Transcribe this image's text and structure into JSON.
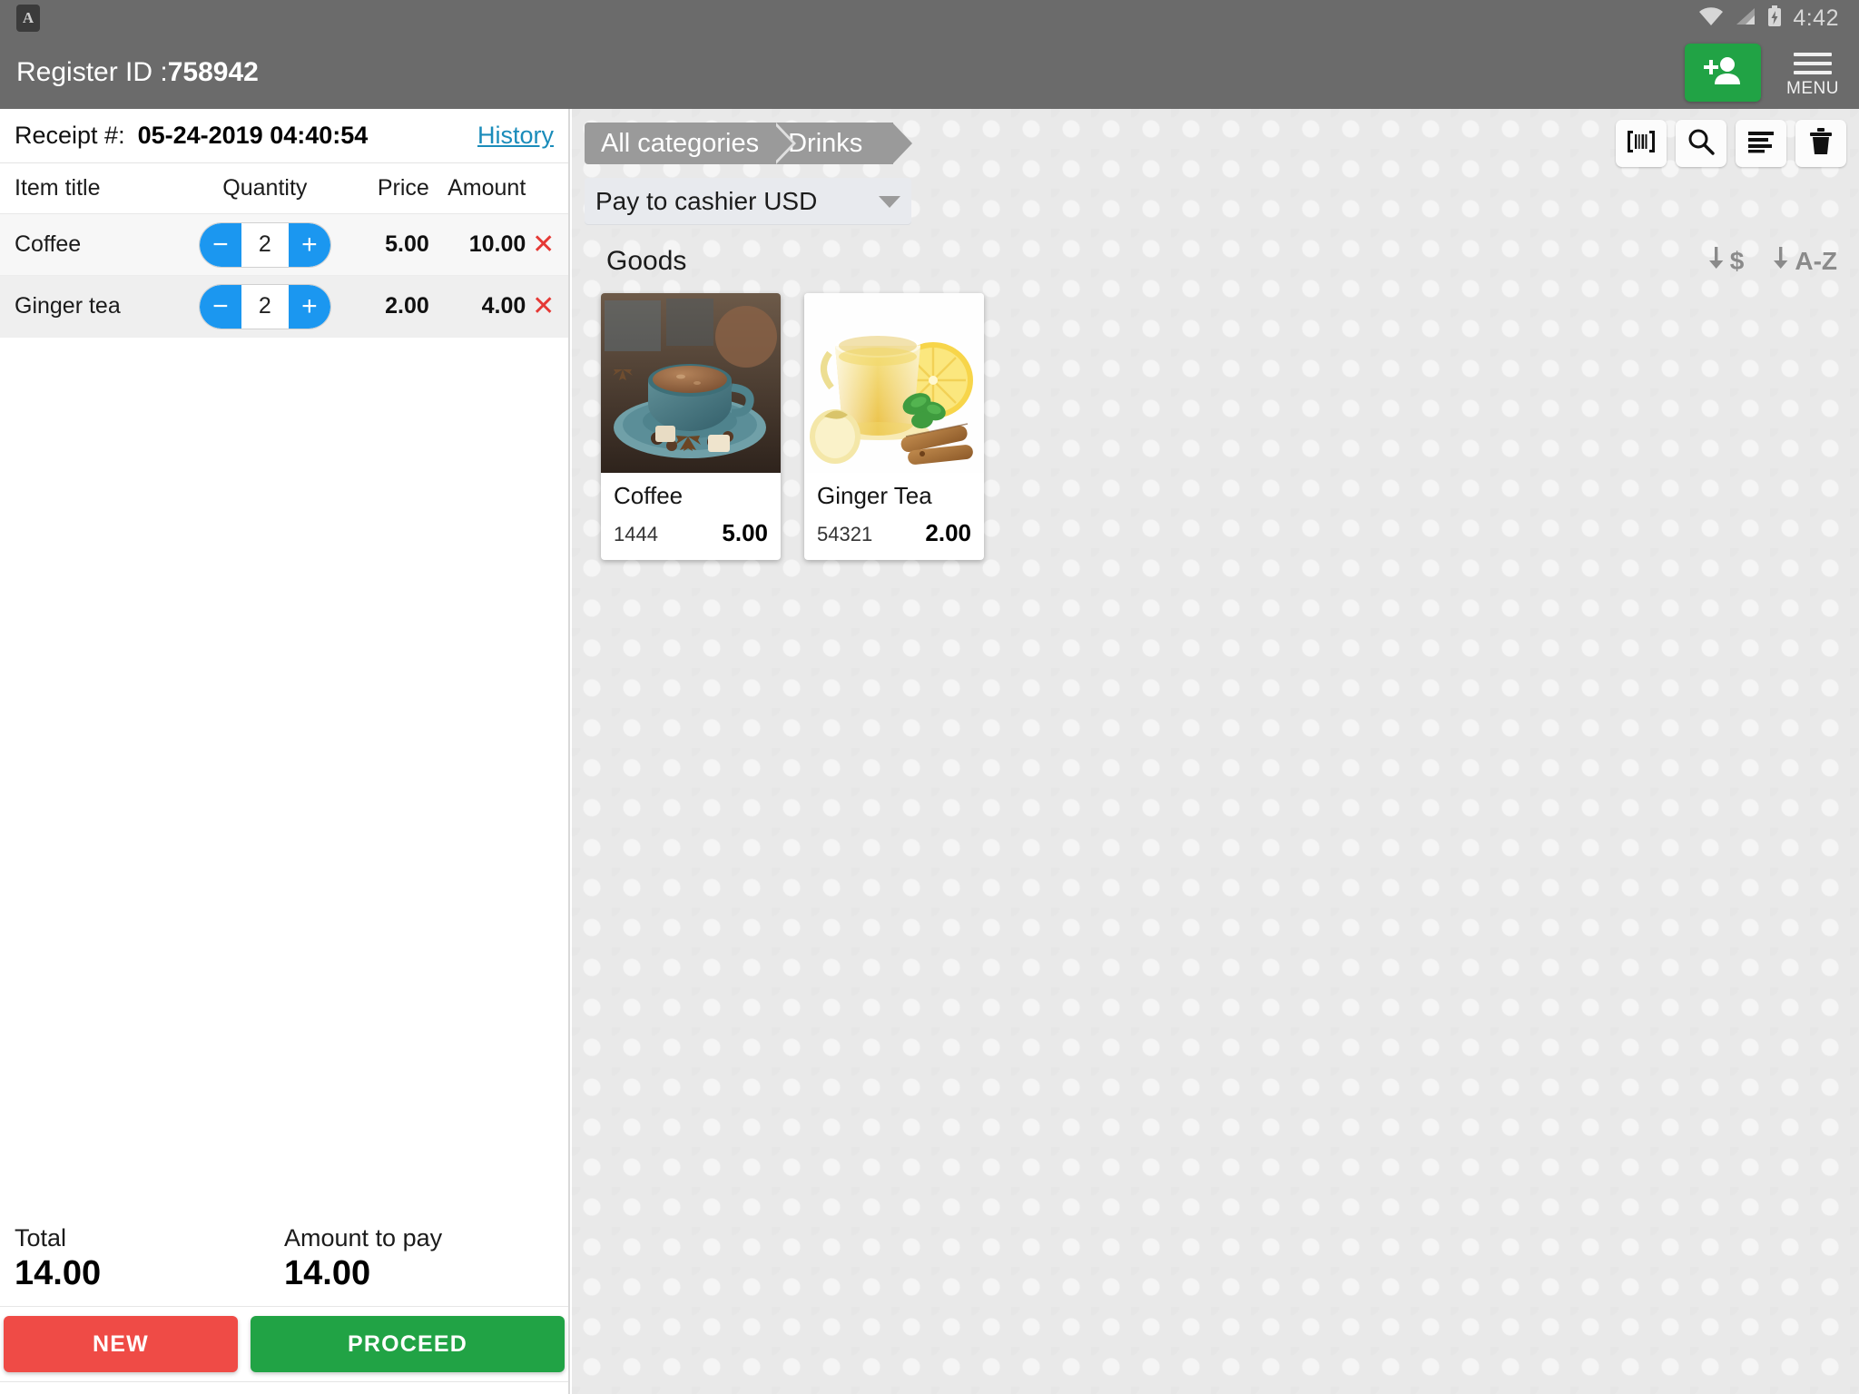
{
  "statusbar": {
    "app_icon": "A",
    "icons": [
      "wifi-icon",
      "signal-icon",
      "battery-charging-icon"
    ],
    "time": "4:42"
  },
  "appbar": {
    "register_label": "Register ID :",
    "register_id": "758942",
    "add_person_icon": "add-person-icon",
    "menu_label": "MENU"
  },
  "receipt": {
    "label": "Receipt #:",
    "number": "05-24-2019 04:40:54",
    "history_link": "History",
    "columns": {
      "title": "Item title",
      "quantity": "Quantity",
      "price": "Price",
      "amount": "Amount"
    },
    "items": [
      {
        "title": "Coffee",
        "quantity": "2",
        "price": "5.00",
        "amount": "10.00",
        "minus": "−",
        "plus": "+",
        "delete": "✕"
      },
      {
        "title": "Ginger tea",
        "quantity": "2",
        "price": "2.00",
        "amount": "4.00",
        "minus": "−",
        "plus": "+",
        "delete": "✕"
      }
    ],
    "total_label": "Total",
    "total_value": "14.00",
    "amount_to_pay_label": "Amount to pay",
    "amount_to_pay_value": "14.00",
    "new_button": "NEW",
    "proceed_button": "PROCEED"
  },
  "goods_panel": {
    "breadcrumb": [
      "All categories",
      "Drinks"
    ],
    "toolbar_icons": [
      "barcode-icon",
      "search-icon",
      "list-icon",
      "trash-icon"
    ],
    "payment_mode": "Pay to cashier USD",
    "section_title": "Goods",
    "sort_price": "$",
    "sort_alpha": "A-Z",
    "products": [
      {
        "name": "Coffee",
        "sku": "1444",
        "price": "5.00"
      },
      {
        "name": "Ginger Tea",
        "sku": "54321",
        "price": "2.00"
      }
    ]
  },
  "colors": {
    "appbar": "#6b6b6b",
    "accent_blue": "#1b97f0",
    "green": "#21a345",
    "red": "#ef4b46",
    "link": "#1a8cba",
    "panel_bg": "#e9e9e9"
  }
}
